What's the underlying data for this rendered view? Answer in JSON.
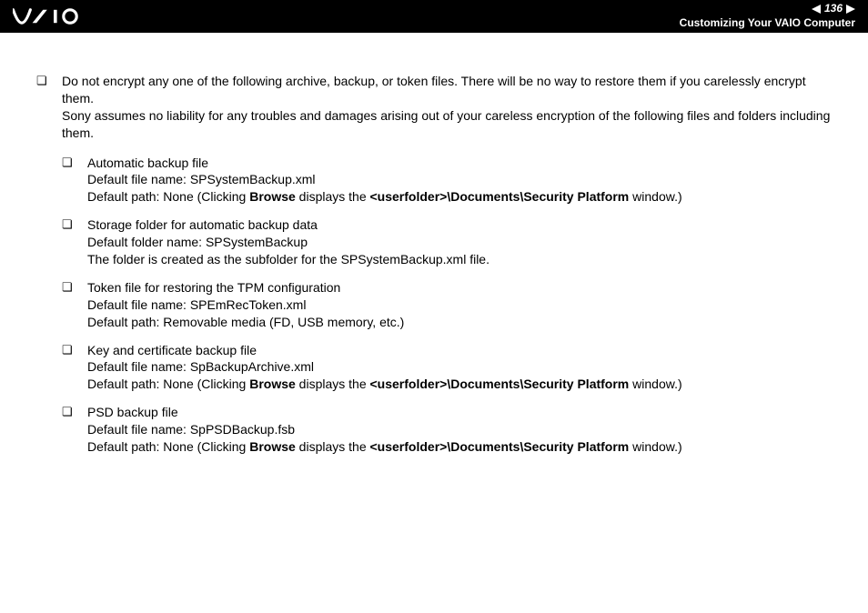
{
  "header": {
    "page_number": "136",
    "breadcrumb": "Customizing Your VAIO Computer"
  },
  "main": {
    "intro_line1": "Do not encrypt any one of the following archive, backup, or token files. There will be no way to restore them if you carelessly encrypt them.",
    "intro_line2": "Sony assumes no liability for any troubles and damages arising out of your careless encryption of the following files and folders including them."
  },
  "items": [
    {
      "title": "Automatic backup file",
      "l2": "Default file name: SPSystemBackup.xml",
      "l3_pre": "Default path: None (Clicking ",
      "l3_b1": "Browse",
      "l3_mid": " displays the ",
      "l3_b2": "<userfolder>\\Documents\\Security Platform",
      "l3_post": " window.)"
    },
    {
      "title": "Storage folder for automatic backup data",
      "l2": "Default folder name: SPSystemBackup",
      "plain_l3": "The folder is created as the subfolder for the SPSystemBackup.xml file."
    },
    {
      "title": "Token file for restoring the TPM configuration",
      "l2": "Default file name: SPEmRecToken.xml",
      "plain_l3": "Default path: Removable media (FD, USB memory, etc.)"
    },
    {
      "title": "Key and certificate backup file",
      "l2": "Default file name: SpBackupArchive.xml",
      "l3_pre": "Default path: None (Clicking ",
      "l3_b1": "Browse",
      "l3_mid": " displays the ",
      "l3_b2": "<userfolder>\\Documents\\Security Platform",
      "l3_post": " window.)"
    },
    {
      "title": "PSD backup file",
      "l2": "Default file name: SpPSDBackup.fsb",
      "l3_pre": "Default path: None (Clicking ",
      "l3_b1": "Browse",
      "l3_mid": " displays the ",
      "l3_b2": "<userfolder>\\Documents\\Security Platform",
      "l3_post": " window.)"
    }
  ]
}
